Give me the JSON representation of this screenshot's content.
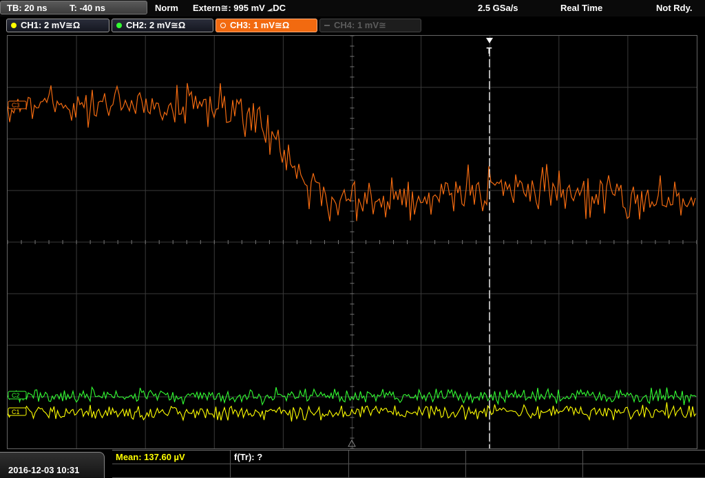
{
  "header": {
    "timebase": "TB: 20 ns",
    "trigger_time": "T: -40 ns",
    "acq_mode": "Norm",
    "trigger_source": "Extern≅: 995 mV ⦟DC",
    "sample_rate": "2.5 GSa/s",
    "acq_type": "Real Time",
    "status": "Not Rdy."
  },
  "channels": [
    {
      "label": "CH1: 2 mV≅Ω",
      "color": "#ffff00",
      "state": "on"
    },
    {
      "label": "CH2: 2 mV≅Ω",
      "color": "#33ff33",
      "state": "on"
    },
    {
      "label": "CH3: 1 mV≅Ω",
      "color": "#f26a10",
      "state": "active"
    },
    {
      "label": "CH4: 1 mV≅",
      "color": "#5c5c5c",
      "state": "off"
    }
  ],
  "markers": {
    "trigger_marker": "T",
    "ch3_marker": "C3",
    "ch2_marker": "C2",
    "ch1_marker": "C1"
  },
  "footer": {
    "datetime": "2016-12-03 10:31",
    "measurements": [
      "Mean: 137.60 µV",
      "f(Tr): ?"
    ]
  },
  "colors": {
    "grid": "#3a3a3a",
    "trigger_line": "#ffffff",
    "ch1": "#ffff00",
    "ch2": "#33ff33",
    "ch3": "#f26a10"
  }
}
